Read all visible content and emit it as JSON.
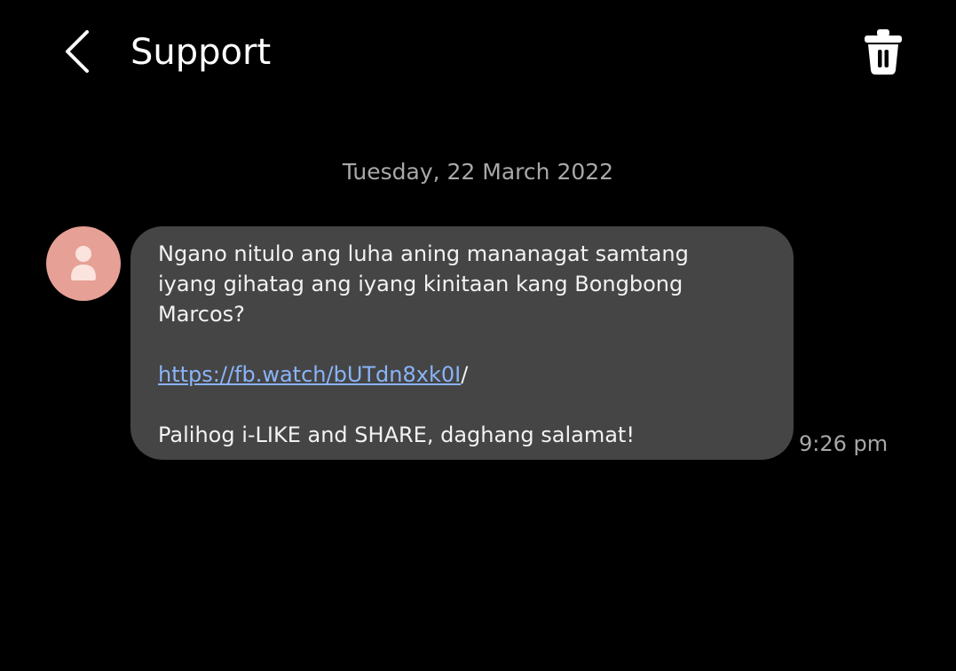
{
  "header": {
    "title": "Support",
    "back_icon": "chevron-left-icon",
    "delete_icon": "trash-icon"
  },
  "conversation": {
    "date_divider": "Tuesday, 22 March 2022",
    "messages": [
      {
        "sender_avatar": "person-icon",
        "text_line_1": "Ngano nitulo ang luha aning mananagat samtang",
        "text_line_2": "iyang gihatag ang iyang kinitaan kang Bongbong",
        "text_line_3": "Marcos?",
        "link": "https://fb.watch/bUTdn8xk0I",
        "link_suffix": "/",
        "closing": "Palihog i-LIKE and SHARE, daghang salamat!",
        "time": "9:26 pm"
      }
    ]
  },
  "colors": {
    "background": "#000000",
    "bubble": "#454545",
    "avatar": "#e6a095",
    "link": "#8ab4f8",
    "muted_text": "#a8a8a8"
  }
}
